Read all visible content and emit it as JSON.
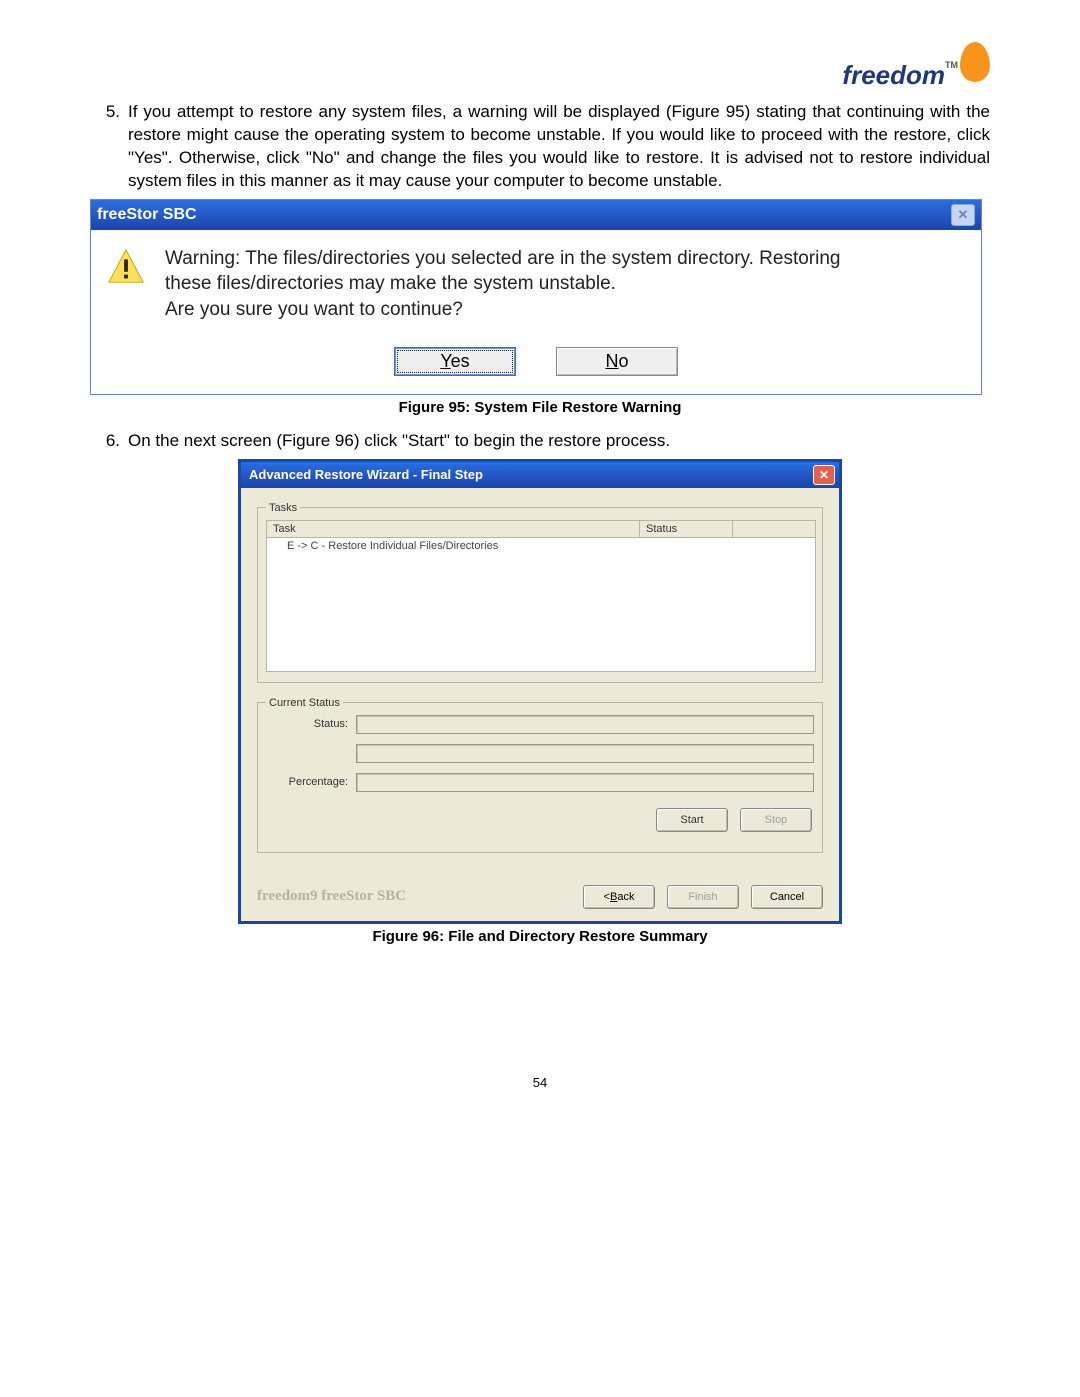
{
  "logo_text": "freedom",
  "logo_tm": "TM",
  "list": {
    "item5_num": "5.",
    "item5_body": "If you attempt to restore any system files, a warning will be displayed (Figure 95) stating that continuing with the restore might cause the operating system to become unstable.  If you would like to proceed with the restore, click \"Yes\".  Otherwise, click \"No\" and change the files you would like to restore.  It is advised not to restore individual system files in this manner as it may cause your computer to become unstable.",
    "item6_num": "6.",
    "item6_body": "On the next screen (Figure 96) click \"Start\" to begin the restore process."
  },
  "dialog1": {
    "title": "freeStor SBC",
    "message_l1": "Warning: The files/directories you selected are in the system directory. Restoring",
    "message_l2": "these files/directories may make the system unstable.",
    "message_l3": "Are you sure you want to continue?",
    "yes_label_u": "Y",
    "yes_label_rest": "es",
    "no_label_u": "N",
    "no_label_rest": "o"
  },
  "fig95_caption": "Figure 95: System File Restore Warning",
  "dialog2": {
    "title": "Advanced Restore Wizard - Final Step",
    "tasks_legend": "Tasks",
    "col_task": "Task",
    "col_status": "Status",
    "row1": "E -> C - Restore Individual Files/Directories",
    "status_legend": "Current Status",
    "status_label": "Status:",
    "percentage_label": "Percentage:",
    "start_btn": "Start",
    "stop_btn": "Stop",
    "brand": "freedom9 freeStor SBC",
    "back_btn_u": "B",
    "back_btn_pre": "< ",
    "back_btn_post": "ack",
    "finish_btn": "Finish",
    "cancel_btn": "Cancel"
  },
  "fig96_caption": "Figure 96: File and Directory Restore Summary",
  "page_number": "54"
}
